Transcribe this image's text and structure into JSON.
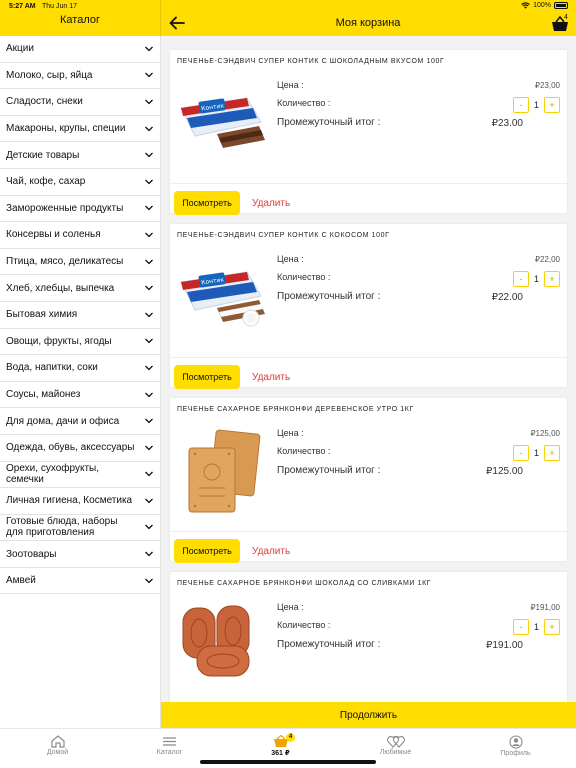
{
  "status_bar": {
    "time": "5:27 AM",
    "date": "Thu Jun 17",
    "battery": "100%"
  },
  "sidebar": {
    "title": "Каталог",
    "items": [
      {
        "label": "Акции"
      },
      {
        "label": "Молоко, сыр, яйца"
      },
      {
        "label": "Сладости, снеки"
      },
      {
        "label": "Макароны, крупы, специи"
      },
      {
        "label": "Детские товары"
      },
      {
        "label": "Чай, кофе, сахар"
      },
      {
        "label": "Замороженные продукты"
      },
      {
        "label": "Консервы и соленья"
      },
      {
        "label": "Птица, мясо, деликатесы"
      },
      {
        "label": "Хлеб, хлебцы, выпечка"
      },
      {
        "label": "Бытовая химия"
      },
      {
        "label": "Овощи, фрукты, ягоды"
      },
      {
        "label": "Вода, напитки, соки"
      },
      {
        "label": "Соусы, майонез"
      },
      {
        "label": "Для дома, дачи и офиса"
      },
      {
        "label": "Одежда, обувь, аксессуары"
      },
      {
        "label": "Орехи, сухофрукты, семечки"
      },
      {
        "label": "Личная гигиена, Косметика"
      },
      {
        "label": "Готовые блюда, наборы для приготовления"
      },
      {
        "label": "Зоотовары"
      },
      {
        "label": "Амвей"
      }
    ]
  },
  "header": {
    "title": "Моя корзина",
    "cart_count": "4"
  },
  "labels": {
    "price": "Цена :",
    "quantity": "Количество :",
    "subtotal": "Промежуточный итог :",
    "view": "Посмотреть",
    "delete": "Удалить",
    "minus": "-",
    "plus": "+"
  },
  "cart_items": [
    {
      "name": "ПЕЧЕНЬЕ-СЭНДВИЧ СУПЕР КОНТИК С ШОКОЛАДНЫМ ВКУСОМ 100Г",
      "price": "₽23,00",
      "quantity": "1",
      "subtotal": "₽23.00",
      "image": "chocolate-sandwich-cookie-image"
    },
    {
      "name": "ПЕЧЕНЬЕ-СЭНДВИЧ СУПЕР КОНТИК С КОКОСОМ 100Г",
      "price": "₽22,00",
      "quantity": "1",
      "subtotal": "₽22.00",
      "image": "coconut-sandwich-cookie-image"
    },
    {
      "name": "ПЕЧЕНЬЕ САХАРНОЕ БРЯНКОНФИ ДЕРЕВЕНСКОЕ УТРО 1КГ",
      "price": "₽125,00",
      "quantity": "1",
      "subtotal": "₽125.00",
      "image": "sugar-cookie-image"
    },
    {
      "name": "ПЕЧЕНЬЕ САХАРНОЕ БРЯНКОНФИ ШОКОЛАД СО СЛИВКАМИ 1КГ",
      "price": "₽191,00",
      "quantity": "1",
      "subtotal": "₽191.00",
      "image": "chocolate-cream-cookie-image"
    }
  ],
  "continue_label": "Продолжить",
  "tabs": [
    {
      "label": "Домой",
      "icon": "home-icon"
    },
    {
      "label": "Каталог",
      "icon": "list-icon"
    },
    {
      "label": "361 ₽",
      "icon": "basket-icon",
      "badge": "4"
    },
    {
      "label": "Любимые",
      "icon": "heart-icon"
    },
    {
      "label": "Профиль",
      "icon": "profile-icon"
    }
  ],
  "colors": {
    "accent": "#ffdd00",
    "delete": "#e53935"
  }
}
